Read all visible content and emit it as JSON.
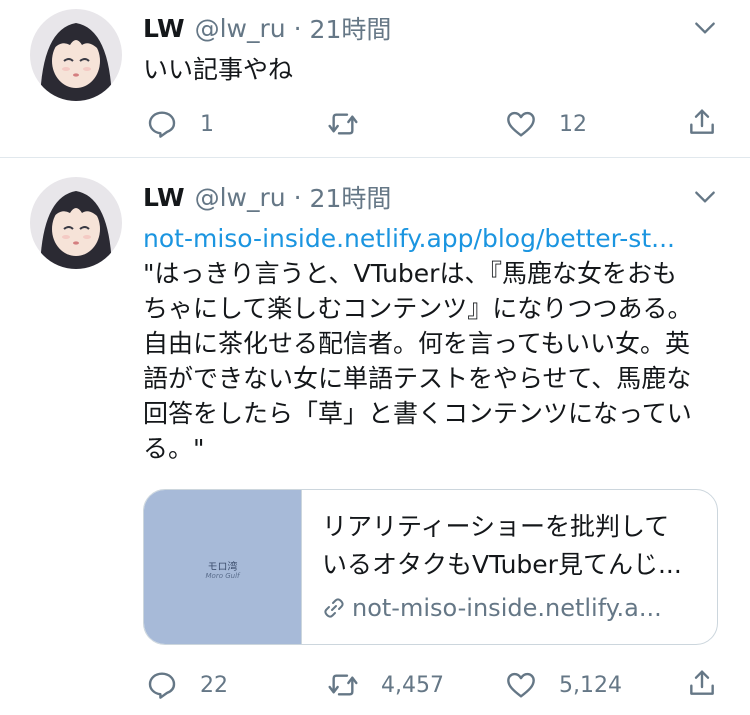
{
  "tweets": [
    {
      "name": "LW",
      "handle": "@lw_ru",
      "separator": "·",
      "time": "21時間",
      "text": "いい記事やね",
      "actions": {
        "reply": "1",
        "retweet": "",
        "like": "12"
      }
    },
    {
      "name": "LW",
      "handle": "@lw_ru",
      "separator": "·",
      "time": "21時間",
      "link": "not-miso-inside.netlify.app/blog/better-st...",
      "text_lines": [
        "\"はっきり言うと、VTuberは、『馬鹿な女をおも",
        "ちゃにして楽しむコンテンツ』になりつつある。",
        "自由に茶化せる配信者。何を言ってもいい女。英",
        "語ができない女に単語テストをやらせて、馬鹿な",
        "回答をしたら「草」と書くコンテンツになってい",
        "る。\""
      ],
      "card": {
        "thumb_title": "モロ湾",
        "thumb_subtitle": "Moro Gulf",
        "title_line1": "リアリティーショーを批判して",
        "title_line2": "いるオタクもVTuber見てんじ...",
        "url": "not-miso-inside.netlify.a..."
      },
      "actions": {
        "reply": "22",
        "retweet": "4,457",
        "like": "5,124"
      }
    }
  ],
  "icons": {
    "reply": "reply-icon",
    "retweet": "retweet-icon",
    "like": "heart-icon",
    "share": "share-icon",
    "menu": "chevron-down-icon",
    "link": "link-icon"
  },
  "colors": {
    "text": "#14171a",
    "secondary": "#657786",
    "link": "#1b95e0",
    "border": "#ccd6dd",
    "thumb": "#a7bad8"
  }
}
